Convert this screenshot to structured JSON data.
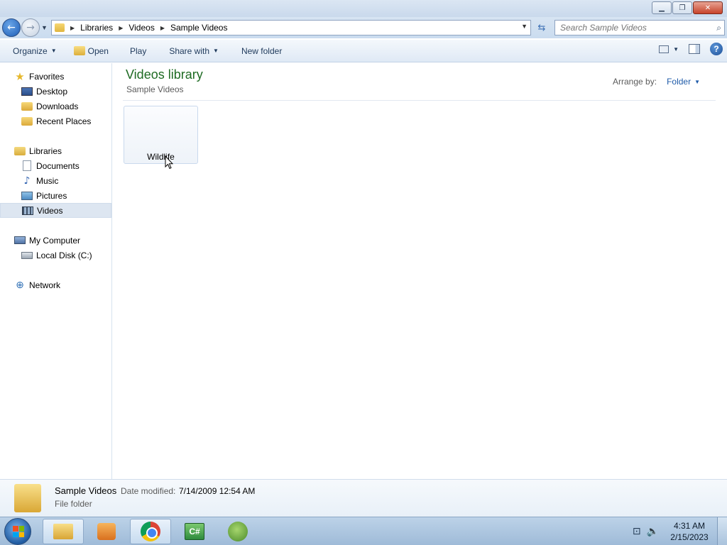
{
  "titlebar": {
    "minimize": "▁",
    "maximize": "❐",
    "close": "✕"
  },
  "address": {
    "crumbs": [
      "Libraries",
      "Videos",
      "Sample Videos"
    ],
    "search_placeholder": "Search Sample Videos"
  },
  "toolbar": {
    "organize": "Organize",
    "open": "Open",
    "play": "Play",
    "share_with": "Share with",
    "new_folder": "New folder",
    "help": "?"
  },
  "sidebar": {
    "favorites": {
      "label": "Favorites",
      "items": [
        {
          "label": "Desktop",
          "icon": "desktop-icon"
        },
        {
          "label": "Downloads",
          "icon": "folder-icon"
        },
        {
          "label": "Recent Places",
          "icon": "recent-icon"
        }
      ]
    },
    "libraries": {
      "label": "Libraries",
      "items": [
        {
          "label": "Documents",
          "icon": "document-icon"
        },
        {
          "label": "Music",
          "icon": "music-icon"
        },
        {
          "label": "Pictures",
          "icon": "pictures-icon"
        },
        {
          "label": "Videos",
          "icon": "video-icon",
          "selected": true
        }
      ]
    },
    "computer": {
      "label": "My Computer",
      "items": [
        {
          "label": "Local Disk (C:)",
          "icon": "disk-icon"
        }
      ]
    },
    "network": {
      "label": "Network"
    }
  },
  "content": {
    "title": "Videos library",
    "subtitle": "Sample Videos",
    "arrange_label": "Arrange by:",
    "arrange_value": "Folder",
    "items": [
      {
        "label": "Wildlife",
        "type": "video"
      }
    ]
  },
  "details": {
    "name": "Sample Videos",
    "date_label": "Date modified:",
    "date_value": "7/14/2009 12:54 AM",
    "type": "File folder"
  },
  "taskbar": {
    "apps": [
      {
        "name": "windows-explorer",
        "active": true
      },
      {
        "name": "media-player"
      },
      {
        "name": "google-chrome"
      },
      {
        "name": "csharp-app",
        "label": "C#"
      },
      {
        "name": "windows7-app"
      }
    ],
    "time": "4:31 AM",
    "date": "2/15/2023"
  },
  "colors": {
    "accent": "#1e5aa8",
    "library_title": "#1e6b23",
    "selection": "#dde6f1"
  }
}
